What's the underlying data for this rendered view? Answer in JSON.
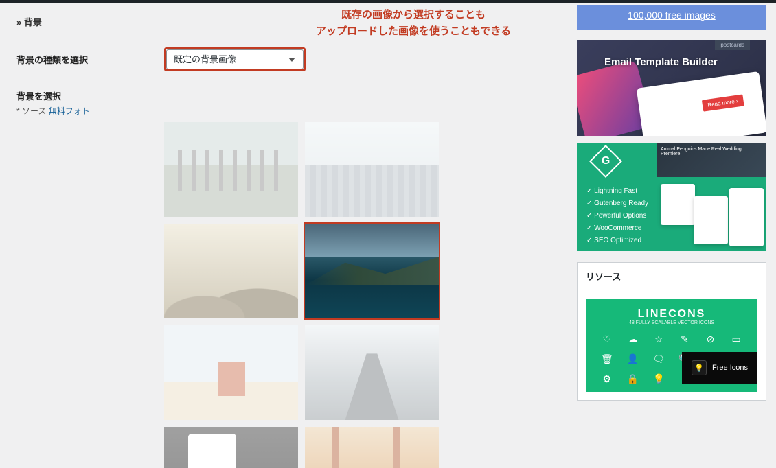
{
  "breadcrumb": "» 背景",
  "annotation": {
    "line1": "既存の画像から選択することも",
    "line2": "アップロードした画像を使うこともできる"
  },
  "bg_type": {
    "label": "背景の種類を選択",
    "selected": "既定の背景画像"
  },
  "bg_select": {
    "label": "背景を選択",
    "source_prefix": "* ソース ",
    "source_link": "無料フォト"
  },
  "ads": {
    "free_images_link": "100,000 free images",
    "email_builder_title": "Email Template Builder",
    "email_builder_btn": "Read more ›",
    "email_builder_tab": "postcards",
    "green": {
      "diamond": "G",
      "features": [
        "Lightning Fast",
        "Gutenberg Ready",
        "Powerful Options",
        "WooCommerce",
        "SEO Optimized"
      ],
      "strip_text": "Animal Penguins Made Real Wedding Premiere"
    }
  },
  "resource": {
    "heading": "リソース",
    "linecons_title": "LINECONS",
    "linecons_sub": "48 FULLY SCALABLE VECTOR ICONS",
    "free_icons": "Free Icons",
    "icons": [
      "♡",
      "☁",
      "☆",
      "✎",
      "⊘",
      "▭",
      "🗑",
      "👤",
      "🗨",
      "🔍",
      "🔒",
      "📷",
      "⚙",
      "🔒",
      "💡"
    ]
  }
}
